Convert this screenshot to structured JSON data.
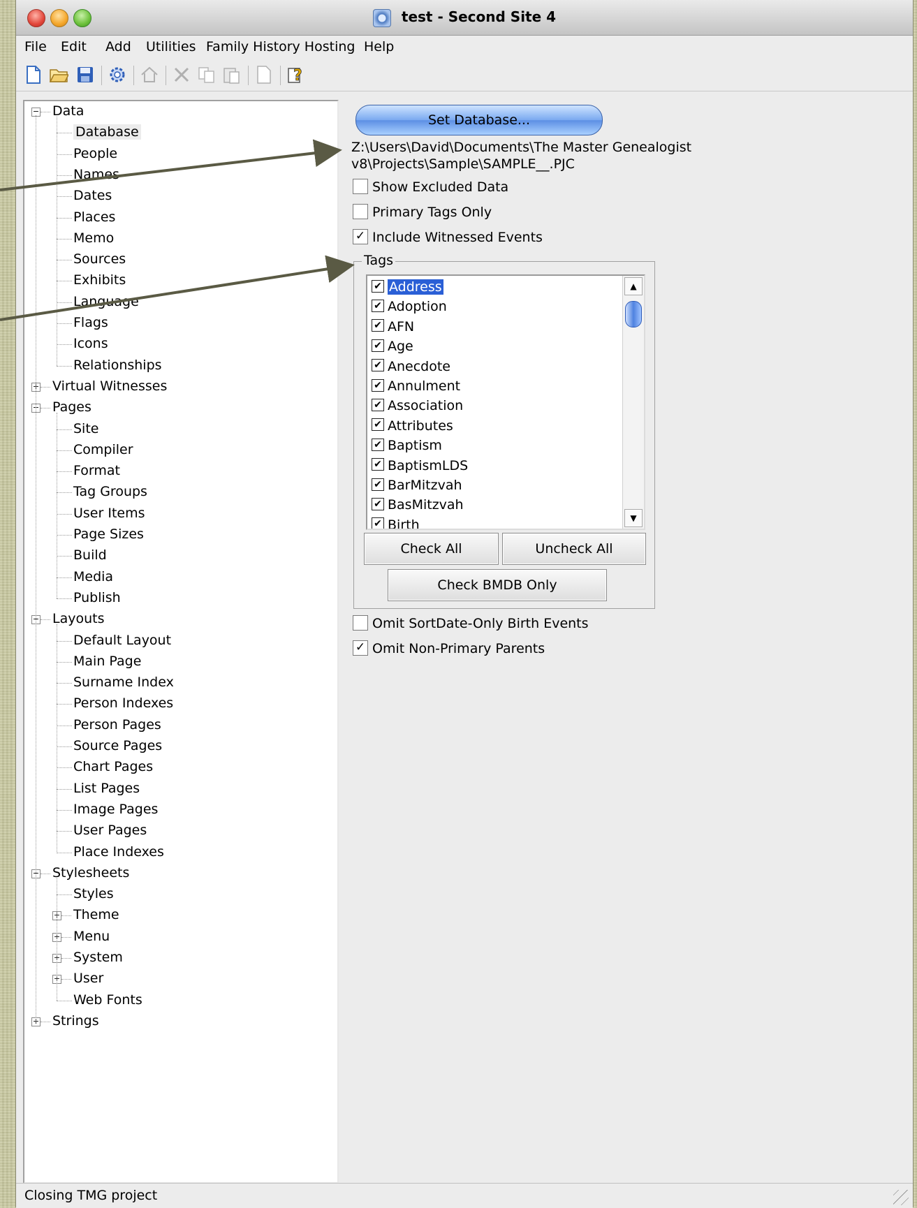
{
  "window": {
    "title": "test - Second Site 4"
  },
  "menu": {
    "file": "File",
    "edit": "Edit",
    "add": "Add",
    "utilities": "Utilities",
    "family_history_hosting": "Family History Hosting",
    "help": "Help"
  },
  "toolbar": {
    "icons": [
      "new-file-icon",
      "open-folder-icon",
      "save-icon",
      "gear-icon",
      "home-icon",
      "cut-icon",
      "copy-icon",
      "paste-icon",
      "blank-page-icon",
      "help-icon"
    ]
  },
  "tree": {
    "data": "Data",
    "data_items": [
      "Database",
      "People",
      "Names",
      "Dates",
      "Places",
      "Memo",
      "Sources",
      "Exhibits",
      "Language",
      "Flags",
      "Icons",
      "Relationships"
    ],
    "virtual_witnesses": "Virtual Witnesses",
    "pages": "Pages",
    "pages_items": [
      "Site",
      "Compiler",
      "Format",
      "Tag Groups",
      "User Items",
      "Page Sizes",
      "Build",
      "Media",
      "Publish"
    ],
    "layouts": "Layouts",
    "layouts_items": [
      "Default Layout",
      "Main Page",
      "Surname Index",
      "Person Indexes",
      "Person Pages",
      "Source Pages",
      "Chart Pages",
      "List Pages",
      "Image Pages",
      "User Pages",
      "Place Indexes"
    ],
    "stylesheets": "Stylesheets",
    "stylesheets_items": [
      "Styles",
      "Theme",
      "Menu",
      "System",
      "User",
      "Web Fonts"
    ],
    "strings": "Strings"
  },
  "database": {
    "set_button": "Set Database...",
    "path_line1": "Z:\\Users\\David\\Documents\\The Master Genealogist",
    "path_line2": "v8\\Projects\\Sample\\SAMPLE__.PJC"
  },
  "options": {
    "show_excluded": {
      "label": "Show Excluded Data",
      "checked": false
    },
    "primary_tags": {
      "label": "Primary Tags Only",
      "checked": false
    },
    "include_witnessed": {
      "label": "Include Witnessed Events",
      "checked": true
    },
    "omit_sortdate": {
      "label": "Omit SortDate-Only Birth Events",
      "checked": false
    },
    "omit_nonprimary": {
      "label": "Omit Non-Primary Parents",
      "checked": true
    }
  },
  "tags": {
    "group_label": "Tags",
    "items": [
      "Address",
      "Adoption",
      "AFN",
      "Age",
      "Anecdote",
      "Annulment",
      "Association",
      "Attributes",
      "Baptism",
      "BaptismLDS",
      "BarMitzvah",
      "BasMitzvah",
      "Birth"
    ],
    "selected": "Address",
    "check_all": "Check All",
    "uncheck_all": "Uncheck All",
    "check_bmdb": "Check BMDB Only"
  },
  "status": {
    "text": "Closing TMG project"
  },
  "colors": {
    "selection": "#2a5fd6",
    "annotation_arrow": "#5a5a44"
  }
}
